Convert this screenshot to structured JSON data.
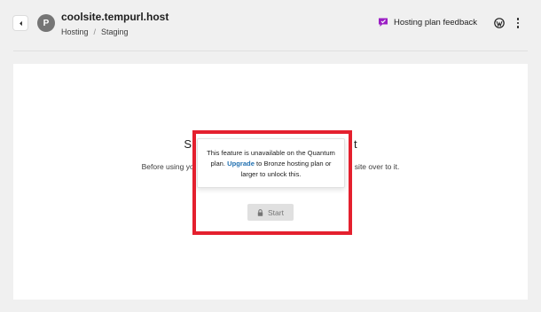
{
  "header": {
    "avatar_letter": "P",
    "site_title": "coolsite.tempurl.host",
    "breadcrumb": [
      "Hosting",
      "Staging"
    ],
    "breadcrumb_separator": "/",
    "feedback_label": "Hosting plan feedback"
  },
  "staging": {
    "title_left": "S",
    "title_right": "t",
    "desc_left": "Before using yo",
    "desc_right": "n site over to it."
  },
  "upsell": {
    "text_before": "This feature is unavailable on the Quantum plan. ",
    "link": "Upgrade",
    "text_after": " to Bronze hosting plan or larger to unlock this."
  },
  "start_button": {
    "label": "Start",
    "icon": "lock-icon"
  },
  "colors": {
    "link": "#2271b1",
    "highlight": "#e4202e",
    "feedback_icon": "#9b1fc4"
  }
}
